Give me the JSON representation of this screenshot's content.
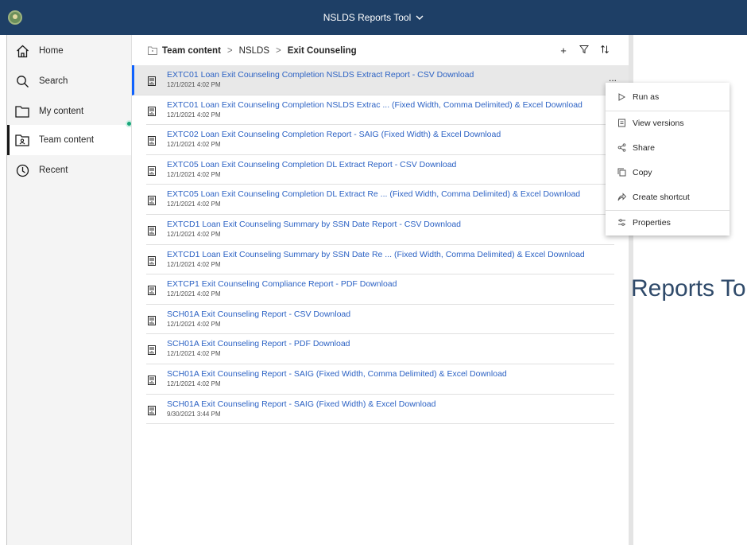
{
  "header": {
    "title": "NSLDS Reports Tool",
    "chevron": "chevron-down-icon"
  },
  "sidebar": {
    "items": [
      {
        "label": "Home",
        "icon": "home-icon"
      },
      {
        "label": "Search",
        "icon": "search-icon"
      },
      {
        "label": "My content",
        "icon": "folder-icon"
      },
      {
        "label": "Team content",
        "icon": "team-folder-icon"
      },
      {
        "label": "Recent",
        "icon": "clock-icon"
      }
    ]
  },
  "breadcrumb": {
    "root": "Team content",
    "middle": "NSLDS",
    "current": "Exit Counseling"
  },
  "toolbar": {
    "add": "+",
    "filter": "filter-icon",
    "sort": "sort-icon"
  },
  "rows": [
    {
      "title": "EXTC01 Loan Exit Counseling Completion NSLDS Extract Report - CSV Download",
      "date": "12/1/2021 4:02 PM",
      "more": "..."
    },
    {
      "title": "EXTC01 Loan Exit Counseling Completion NSLDS Extrac ... (Fixed Width, Comma Delimited) & Excel Download",
      "date": "12/1/2021 4:02 PM"
    },
    {
      "title": "EXTC02 Loan Exit Counseling Completion Report - SAIG (Fixed Width) & Excel Download",
      "date": "12/1/2021 4:02 PM"
    },
    {
      "title": "EXTC05 Loan Exit Counseling Completion DL Extract Report - CSV Download",
      "date": "12/1/2021 4:02 PM"
    },
    {
      "title": "EXTC05 Loan Exit Counseling Completion DL Extract Re ... (Fixed Width, Comma Delimited) & Excel Download",
      "date": "12/1/2021 4:02 PM"
    },
    {
      "title": "EXTCD1 Loan Exit Counseling Summary by SSN Date Report - CSV Download",
      "date": "12/1/2021 4:02 PM"
    },
    {
      "title": "EXTCD1 Loan Exit Counseling Summary by SSN Date Re ... (Fixed Width, Comma Delimited) & Excel Download",
      "date": "12/1/2021 4:02 PM"
    },
    {
      "title": "EXTCP1 Exit Counseling Compliance Report - PDF Download",
      "date": "12/1/2021 4:02 PM"
    },
    {
      "title": "SCH01A Exit Counseling Report - CSV Download",
      "date": "12/1/2021 4:02 PM"
    },
    {
      "title": "SCH01A Exit Counseling Report - PDF Download",
      "date": "12/1/2021 4:02 PM"
    },
    {
      "title": "SCH01A Exit Counseling Report - SAIG (Fixed Width, Comma Delimited) & Excel Download",
      "date": "12/1/2021 4:02 PM"
    },
    {
      "title": "SCH01A Exit Counseling Report - SAIG (Fixed Width) & Excel Download",
      "date": "9/30/2021 3:44 PM"
    }
  ],
  "context_menu": {
    "items": [
      {
        "label": "Run as",
        "icon": "play-icon"
      },
      {
        "label": "View versions",
        "icon": "versions-icon"
      },
      {
        "label": "Share",
        "icon": "share-icon"
      },
      {
        "label": "Copy",
        "icon": "copy-icon"
      },
      {
        "label": "Create shortcut",
        "icon": "shortcut-icon"
      },
      {
        "label": "Properties",
        "icon": "properties-icon"
      }
    ]
  },
  "right_panel": {
    "text": "Reports To"
  },
  "colors": {
    "header_bg": "#1e3f66",
    "link": "#2c62c4",
    "accent": "#0f62fe",
    "status_dot": "#19a67b"
  }
}
